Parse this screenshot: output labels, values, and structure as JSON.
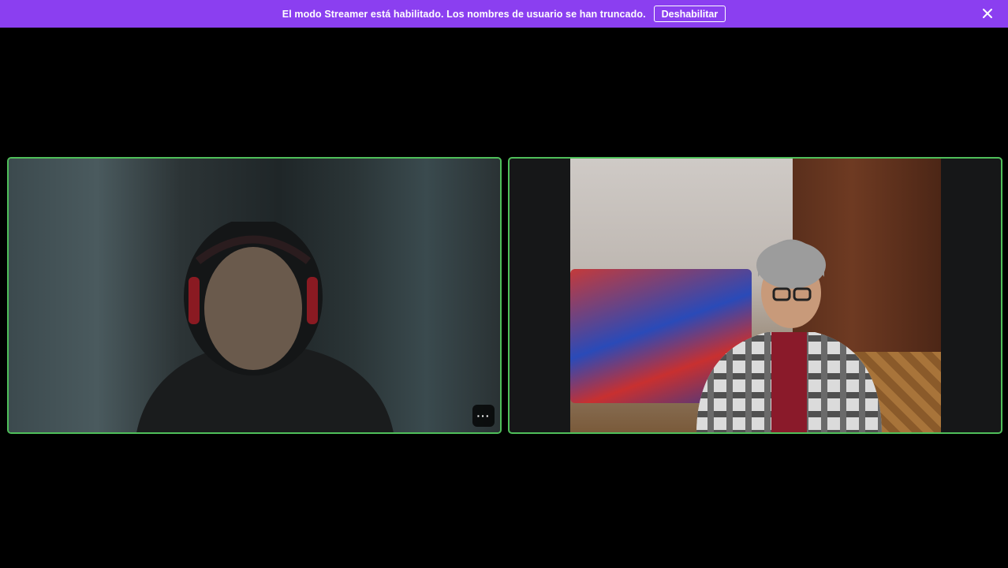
{
  "banner": {
    "message": "El modo Streamer está habilitado. Los nombres de usuario se han truncado.",
    "button_label": "Deshabilitar",
    "close_icon": "close-icon",
    "background_color": "#8b3ff0"
  },
  "tiles": [
    {
      "name": "participant-video-left",
      "speaking_border_color": "#4fbf5a",
      "more_icon": "more-options-icon",
      "more_label": "···"
    },
    {
      "name": "participant-video-right",
      "speaking_border_color": "#4fbf5a"
    }
  ]
}
